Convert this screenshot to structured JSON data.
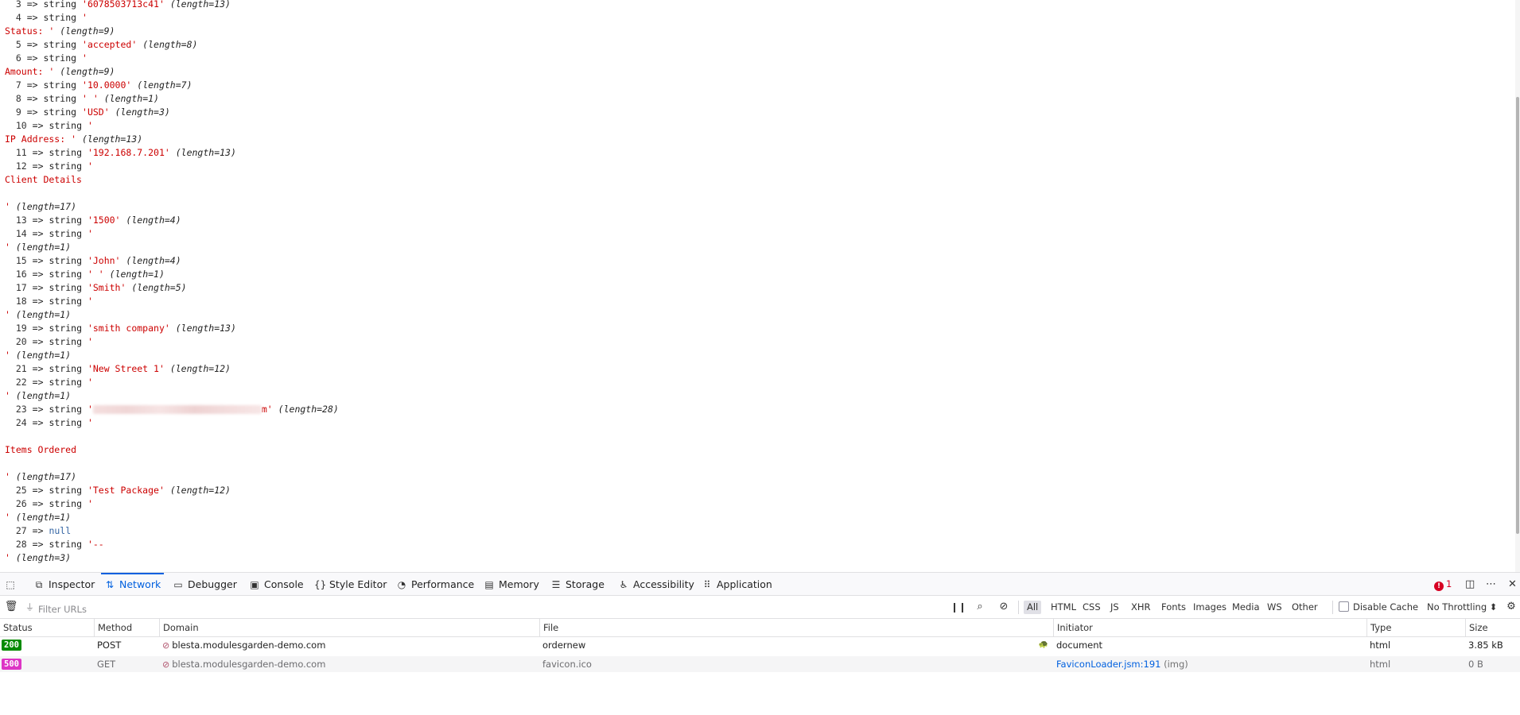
{
  "dump": {
    "lines": [
      {
        "type": "entry",
        "index": "3",
        "value": "'6078503713c41'",
        "length": "(length=13)"
      },
      {
        "type": "entry",
        "index": "4",
        "value": "'",
        "length": ""
      },
      {
        "type": "cont",
        "text": "Status: '",
        "length": "(length=9)"
      },
      {
        "type": "entry",
        "index": "5",
        "value": "'accepted'",
        "length": "(length=8)"
      },
      {
        "type": "entry",
        "index": "6",
        "value": "'",
        "length": ""
      },
      {
        "type": "cont",
        "text": "Amount: '",
        "length": "(length=9)"
      },
      {
        "type": "entry",
        "index": "7",
        "value": "'10.0000'",
        "length": "(length=7)"
      },
      {
        "type": "entry",
        "index": "8",
        "value": "' '",
        "length": "(length=1)"
      },
      {
        "type": "entry",
        "index": "9",
        "value": "'USD'",
        "length": "(length=3)"
      },
      {
        "type": "entry",
        "index": "10",
        "value": "'",
        "length": ""
      },
      {
        "type": "cont",
        "text": "IP Address: '",
        "length": "(length=13)"
      },
      {
        "type": "entry",
        "index": "11",
        "value": "'192.168.7.201'",
        "length": "(length=13)"
      },
      {
        "type": "entry",
        "index": "12",
        "value": "'",
        "length": ""
      },
      {
        "type": "cont",
        "text": "Client Details",
        "length": ""
      },
      {
        "type": "blank"
      },
      {
        "type": "cont",
        "text": "'",
        "length": "(length=17)"
      },
      {
        "type": "entry",
        "index": "13",
        "value": "'1500'",
        "length": "(length=4)"
      },
      {
        "type": "entry",
        "index": "14",
        "value": "'",
        "length": ""
      },
      {
        "type": "cont",
        "text": "'",
        "length": "(length=1)"
      },
      {
        "type": "entry",
        "index": "15",
        "value": "'John'",
        "length": "(length=4)"
      },
      {
        "type": "entry",
        "index": "16",
        "value": "' '",
        "length": "(length=1)"
      },
      {
        "type": "entry",
        "index": "17",
        "value": "'Smith'",
        "length": "(length=5)"
      },
      {
        "type": "entry",
        "index": "18",
        "value": "'",
        "length": ""
      },
      {
        "type": "cont",
        "text": "'",
        "length": "(length=1)"
      },
      {
        "type": "entry",
        "index": "19",
        "value": "'smith company'",
        "length": "(length=13)"
      },
      {
        "type": "entry",
        "index": "20",
        "value": "'",
        "length": ""
      },
      {
        "type": "cont",
        "text": "'",
        "length": "(length=1)"
      },
      {
        "type": "entry",
        "index": "21",
        "value": "'New Street 1'",
        "length": "(length=12)"
      },
      {
        "type": "entry",
        "index": "22",
        "value": "'",
        "length": ""
      },
      {
        "type": "cont",
        "text": "'",
        "length": "(length=1)"
      },
      {
        "type": "entry-redacted",
        "index": "23",
        "pre": "'",
        "post": "m'",
        "length": "(length=28)"
      },
      {
        "type": "entry",
        "index": "24",
        "value": "'",
        "length": ""
      },
      {
        "type": "blank"
      },
      {
        "type": "cont",
        "text": "Items Ordered",
        "length": ""
      },
      {
        "type": "blank"
      },
      {
        "type": "cont",
        "text": "'",
        "length": "(length=17)"
      },
      {
        "type": "entry",
        "index": "25",
        "value": "'Test Package'",
        "length": "(length=12)"
      },
      {
        "type": "entry",
        "index": "26",
        "value": "'",
        "length": ""
      },
      {
        "type": "cont",
        "text": "'",
        "length": "(length=1)"
      },
      {
        "type": "null",
        "index": "27",
        "value": "null"
      },
      {
        "type": "entry",
        "index": "28",
        "value": "'--",
        "length": ""
      },
      {
        "type": "cont",
        "text": "'",
        "length": "(length=3)"
      }
    ],
    "arrow": "=>",
    "string_kw": "string",
    "scroll_position": 0.72
  },
  "devtools": {
    "tabs": [
      {
        "name": "inspector",
        "label": "Inspector",
        "icon": "inspector-icon",
        "glyph": "⧉"
      },
      {
        "name": "network",
        "label": "Network",
        "icon": "network-icon",
        "glyph": "⇅",
        "selected": true
      },
      {
        "name": "debugger",
        "label": "Debugger",
        "icon": "debugger-icon",
        "glyph": "▭"
      },
      {
        "name": "console",
        "label": "Console",
        "icon": "console-icon",
        "glyph": "▣"
      },
      {
        "name": "style-editor",
        "label": "Style Editor",
        "icon": "style-editor-icon",
        "glyph": "{}"
      },
      {
        "name": "performance",
        "label": "Performance",
        "icon": "performance-icon",
        "glyph": "◔"
      },
      {
        "name": "memory",
        "label": "Memory",
        "icon": "memory-icon",
        "glyph": "▤"
      },
      {
        "name": "storage",
        "label": "Storage",
        "icon": "storage-icon",
        "glyph": "☰"
      },
      {
        "name": "accessibility",
        "label": "Accessibility",
        "icon": "accessibility-icon",
        "glyph": "♿"
      },
      {
        "name": "application",
        "label": "Application",
        "icon": "application-icon",
        "glyph": "⠿"
      }
    ],
    "error_count": "1",
    "filter_placeholder": "Filter URLs",
    "type_filters": [
      {
        "label": "All",
        "active": true
      },
      {
        "label": "HTML"
      },
      {
        "label": "CSS"
      },
      {
        "label": "JS"
      },
      {
        "label": "XHR"
      },
      {
        "label": "Fonts"
      },
      {
        "label": "Images"
      },
      {
        "label": "Media"
      },
      {
        "label": "WS"
      },
      {
        "label": "Other"
      }
    ],
    "disable_cache_label": "Disable Cache",
    "disable_cache_checked": false,
    "throttling_label": "No Throttling ⬍",
    "columns": [
      "Status",
      "Method",
      "Domain",
      "File",
      "Initiator",
      "Type",
      "Size"
    ],
    "requests": [
      {
        "status": "200",
        "status_color": "#058b00",
        "method": "POST",
        "domain": "blesta.modulesgarden-demo.com",
        "file": "ordernew",
        "initiator": "document",
        "initiator_link": false,
        "initiator_type": "",
        "type": "html",
        "size": "3.85 kB"
      },
      {
        "status": "500",
        "status_color": "#dd35c5",
        "method": "GET",
        "domain": "blesta.modulesgarden-demo.com",
        "file": "favicon.ico",
        "initiator": "FaviconLoader.jsm:191",
        "initiator_link": true,
        "initiator_type": "(img)",
        "type": "html",
        "size": "0 B"
      }
    ]
  }
}
